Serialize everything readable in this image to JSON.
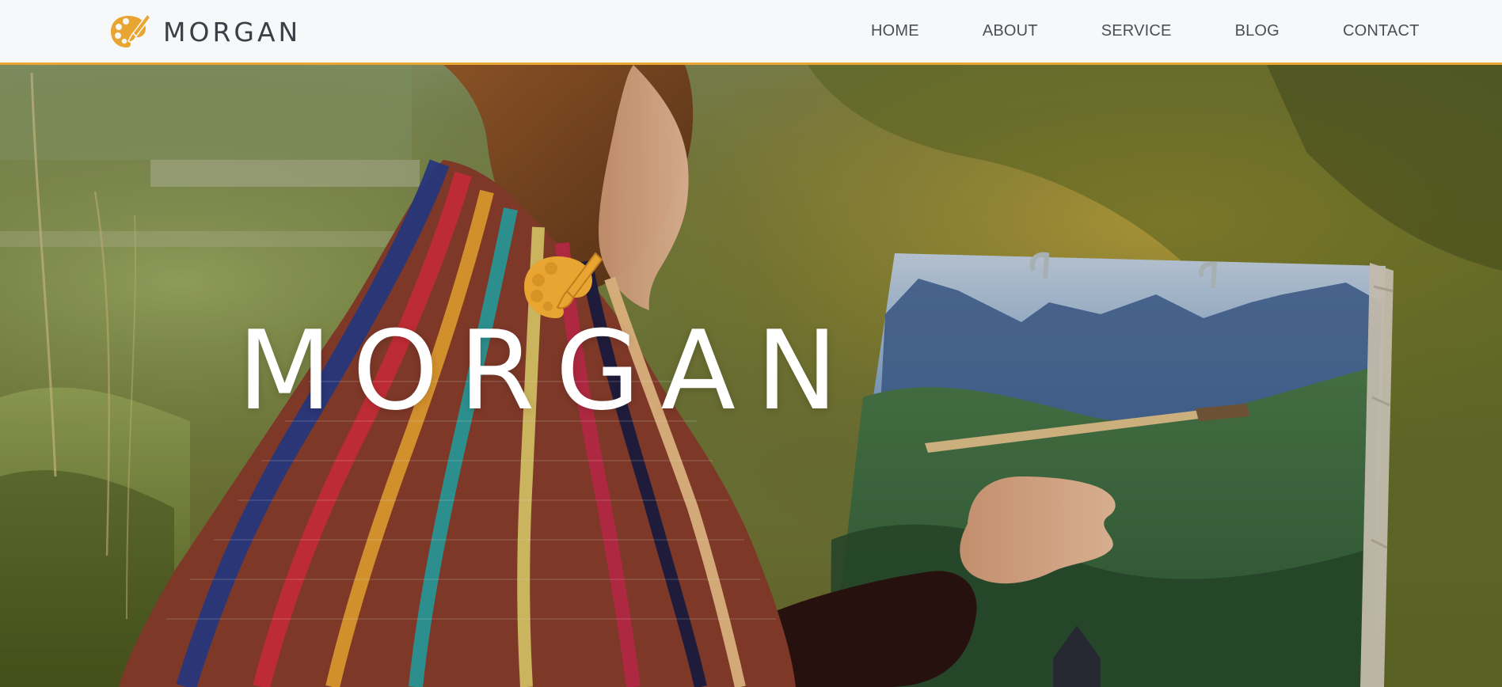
{
  "brand": {
    "name": "MORGAN",
    "icon": "palette-brush-icon",
    "accent_color": "#e8a531"
  },
  "nav": {
    "items": [
      {
        "label": "HOME"
      },
      {
        "label": "ABOUT"
      },
      {
        "label": "SERVICE"
      },
      {
        "label": "BLOG"
      },
      {
        "label": "CONTACT"
      }
    ]
  },
  "hero": {
    "title": "MORGAN",
    "icon": "palette-brush-icon",
    "background": "woman-painting-landscape-on-easel-outdoors"
  }
}
